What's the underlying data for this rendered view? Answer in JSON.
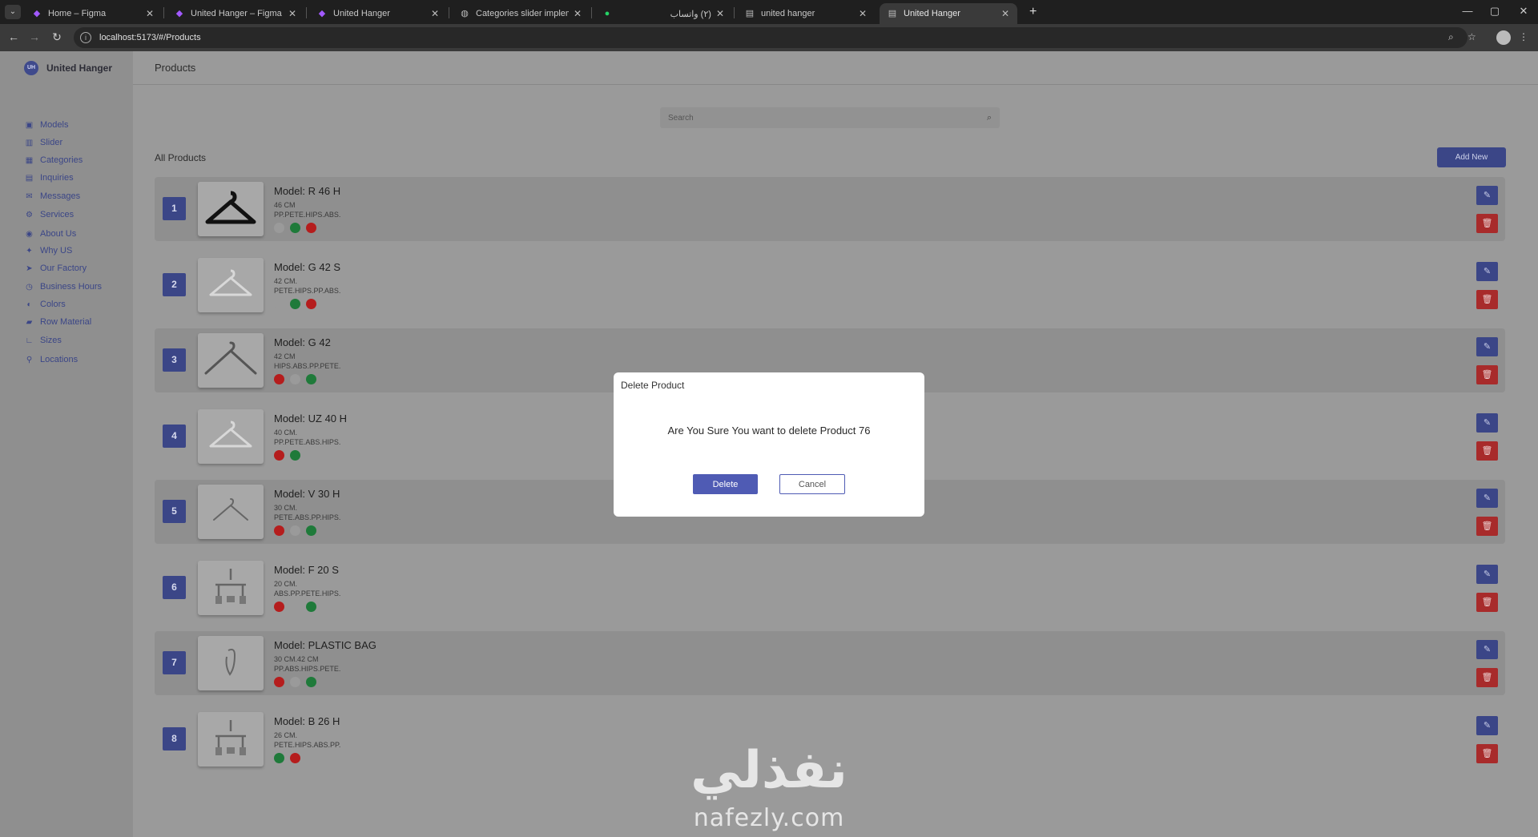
{
  "browser": {
    "tabs": [
      {
        "title": "Home – Figma",
        "icon": "figma-icon"
      },
      {
        "title": "United Hanger – Figma",
        "icon": "figma-icon"
      },
      {
        "title": "United Hanger",
        "icon": "figma-icon"
      },
      {
        "title": "Categories slider implementati",
        "icon": "globe-icon"
      },
      {
        "title": "(٢) واتساب",
        "icon": "whatsapp-icon"
      },
      {
        "title": "united hanger",
        "icon": "page-icon"
      },
      {
        "title": "United Hanger",
        "icon": "page-icon",
        "active": true
      }
    ],
    "url": "localhost:5173/#/Products"
  },
  "app": {
    "brand_logo": "UH",
    "brand_name": "United Hanger",
    "page_title": "Products",
    "accent_color": "#3b4687",
    "danger_color": "#a82b2b"
  },
  "sidebar": {
    "items": [
      {
        "label": "Models",
        "icon": "models-icon"
      },
      {
        "label": "Slider",
        "icon": "slider-icon"
      },
      {
        "label": "Categories",
        "icon": "categories-icon"
      },
      {
        "label": "Inquiries",
        "icon": "inquiries-icon"
      },
      {
        "label": "Messages",
        "icon": "messages-icon"
      },
      {
        "label": "Services",
        "icon": "services-icon"
      },
      {
        "label": "About Us",
        "icon": "about-icon"
      },
      {
        "label": "Why US",
        "icon": "why-us-icon"
      },
      {
        "label": "Our Factory",
        "icon": "factory-icon"
      },
      {
        "label": "Business Hours",
        "icon": "clock-icon"
      },
      {
        "label": "Colors",
        "icon": "palette-icon"
      },
      {
        "label": "Row Material",
        "icon": "material-icon"
      },
      {
        "label": "Sizes",
        "icon": "ruler-icon"
      },
      {
        "label": "Locations",
        "icon": "location-pin-icon"
      }
    ]
  },
  "search": {
    "placeholder": "Search"
  },
  "products_section": {
    "title": "All Products",
    "add_label": "Add New"
  },
  "products": [
    {
      "num": "1",
      "name": "Model: R 46 H",
      "size": "46 CM",
      "materials": "PP.PETE.HIPS.ABS.",
      "colors": [
        "#9a9a9a",
        "#1f7a3a",
        "#b51d1d"
      ],
      "thumb": "black-hanger"
    },
    {
      "num": "2",
      "name": "Model: G 42 S",
      "size": "42 CM.",
      "materials": "PETE.HIPS.PP.ABS.",
      "colors": [
        "#9a9a9a",
        "#1f7a3a",
        "#b51d1d"
      ],
      "thumb": "clear-hanger"
    },
    {
      "num": "3",
      "name": "Model: G 42",
      "size": "42 CM",
      "materials": "HIPS.ABS.PP.PETE.",
      "colors": [
        "#b51d1d",
        "#9a9a9a",
        "#1f7a3a"
      ],
      "thumb": "grey-hanger"
    },
    {
      "num": "4",
      "name": "Model: UZ 40 H",
      "size": "40 CM.",
      "materials": "PP.PETE.ABS.HIPS.",
      "colors": [
        "#b51d1d",
        "#1f7a3a"
      ],
      "thumb": "clear-hanger"
    },
    {
      "num": "5",
      "name": "Model: V 30 H",
      "size": "30 CM.",
      "materials": "PETE.ABS.PP.HIPS.",
      "colors": [
        "#b51d1d",
        "#9a9a9a",
        "#1f7a3a"
      ],
      "thumb": "small-hanger"
    },
    {
      "num": "6",
      "name": "Model: F 20 S",
      "size": "20 CM.",
      "materials": "ABS.PP.PETE.HIPS.",
      "colors": [
        "#b51d1d",
        "#9a9a9a",
        "#1f7a3a"
      ],
      "thumb": "clip-hanger"
    },
    {
      "num": "7",
      "name": "Model: PLASTIC BAG",
      "size": "30 CM.42 CM",
      "materials": "PP.ABS.HIPS.PETE.",
      "colors": [
        "#b51d1d",
        "#9a9a9a",
        "#1f7a3a"
      ],
      "thumb": "bag"
    },
    {
      "num": "8",
      "name": "Model: B 26 H",
      "size": "26 CM.",
      "materials": "PETE.HIPS.ABS.PP.",
      "colors": [
        "#1f7a3a",
        "#b51d1d"
      ],
      "thumb": "clip-hanger"
    }
  ],
  "modal": {
    "title": "Delete Product",
    "message": "Are You Sure You want to delete Product 76",
    "confirm_label": "Delete",
    "cancel_label": "Cancel"
  },
  "watermark": {
    "arabic": "نفذلي",
    "latin": "nafezly.com"
  }
}
